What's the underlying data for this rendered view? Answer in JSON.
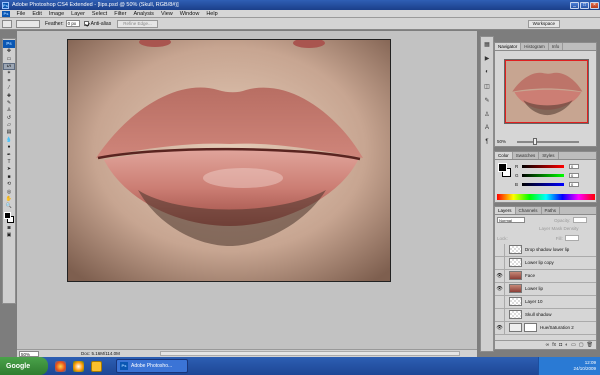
{
  "window": {
    "title": "Adobe Photoshop CS4 Extended - [lips.psd @ 50% (Skull, RGB/8#)]"
  },
  "menu": [
    "File",
    "Edit",
    "Image",
    "Layer",
    "Select",
    "Filter",
    "Analysis",
    "View",
    "Window",
    "Help"
  ],
  "options": {
    "feather_label": "Feather:",
    "feather_value": "0 px",
    "antialias_label": "Anti-alias",
    "refine_edge": "Refine Edge...",
    "workspace": "Workspace"
  },
  "status": {
    "zoom": "50%",
    "doc": "Doc: 5.16M/114.0M"
  },
  "navigator": {
    "tabs": [
      "Navigator",
      "Histogram",
      "Info"
    ],
    "zoom": "50%"
  },
  "color": {
    "tabs": [
      "Color",
      "Swatches",
      "Styles"
    ],
    "rows": [
      {
        "label": "R",
        "value": "0"
      },
      {
        "label": "G",
        "value": "0"
      },
      {
        "label": "B",
        "value": "0"
      }
    ],
    "colors": {
      "accent": "#0a57b3"
    }
  },
  "layers": {
    "tabs": [
      "Layers",
      "Channels",
      "Paths"
    ],
    "blend_mode": "Normal",
    "opacity_label": "Opacity:",
    "mask_label": "Layer Mask Density",
    "lock_label": "Lock:",
    "fill_label": "Fill:",
    "items": [
      {
        "name": "Drop shadow lower lip",
        "visible": false,
        "kind": "empty"
      },
      {
        "name": "Lower lip copy",
        "visible": false,
        "kind": "empty"
      },
      {
        "name": "Face",
        "visible": true,
        "kind": "lip"
      },
      {
        "name": "Lower lip",
        "visible": true,
        "kind": "lip"
      },
      {
        "name": "Layer 10",
        "visible": false,
        "kind": "empty"
      },
      {
        "name": "Skull shadow",
        "visible": false,
        "kind": "empty"
      },
      {
        "name": "Hue/Saturation 2",
        "visible": true,
        "kind": "adjust"
      }
    ]
  },
  "taskbar": {
    "start": "Google",
    "task": "Adobe Photosho...",
    "time": "12:09",
    "date": "24/10/2009"
  }
}
